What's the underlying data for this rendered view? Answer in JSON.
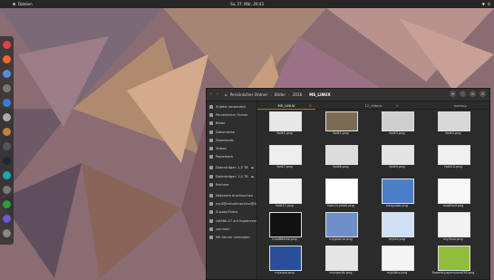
{
  "topbar": {
    "activities": "Dateien",
    "clock": "Sa, 27. Mär, 20:43",
    "tray": [
      "▼",
      "⏻"
    ]
  },
  "colors": {
    "accent": "#e95420",
    "panel": "#262626",
    "window": "#2b2b2b"
  },
  "dock": {
    "items": [
      {
        "name": "chrome-icon",
        "color": "#d44"
      },
      {
        "name": "firefox-icon",
        "color": "#e96a2a"
      },
      {
        "name": "chromium-icon",
        "color": "#5b8bd6"
      },
      {
        "name": "headphones-icon",
        "color": "#777"
      },
      {
        "name": "app-icon",
        "color": "#3a7bd5"
      },
      {
        "name": "gnome-icon",
        "color": "#aaa"
      },
      {
        "name": "files-icon",
        "color": "#c0813f"
      },
      {
        "name": "terminal-icon",
        "color": "#555"
      },
      {
        "name": "steam-icon",
        "color": "#1b2838"
      },
      {
        "name": "app-teal-icon",
        "color": "#1aa8a8"
      },
      {
        "name": "usb-icon",
        "color": "#777"
      },
      {
        "name": "spreadsheet-icon",
        "color": "#2c9d3f"
      },
      {
        "name": "disk-icon",
        "color": "#6a5acd"
      },
      {
        "name": "grid-icon",
        "color": "#888"
      }
    ]
  },
  "window": {
    "breadcrumbs": [
      "Persönlicher Ordner",
      "Bilder",
      "2016",
      "MS_LINUX"
    ],
    "sidebar": [
      "Zuletzt verwendet",
      "Persönlicher Ordner",
      "Bilder",
      "Dokumente",
      "Downloads",
      "Videos",
      "Papierkorb",
      "Datenträger: 1,0 TB",
      "Datenträger: 1,0 TB",
      "Rechner",
      "Netzwerk durchsuchen",
      "mp3@virtualmachine@Sch...",
      "Zusatz/Shims",
      "vdl66b-47 auf ingebrenes...",
      "common",
      "Mit Server verbinden"
    ],
    "tabs": [
      "MS_LINUX",
      "12_Videos",
      "backup"
    ],
    "files": [
      [
        "fsdk1.png",
        "fsdk2.png",
        "fsdk3.png",
        "fsdk4.png"
      ],
      [
        "fsdk7.png",
        "fsdk8.png",
        "fsdk9.png",
        "fsdk10.png"
      ],
      [
        "fsdk11.png",
        "fsdk14.jshell.png",
        "kdeguide.png",
        "modifsdf.png"
      ],
      [
        "mux8demo.png",
        "mygnome.png",
        "mycie.png",
        "mylinux.png"
      ],
      [
        "mysuse.png",
        "mycoords.png",
        "mydisks.png",
        "Powerby.opensuse038.png"
      ]
    ]
  }
}
